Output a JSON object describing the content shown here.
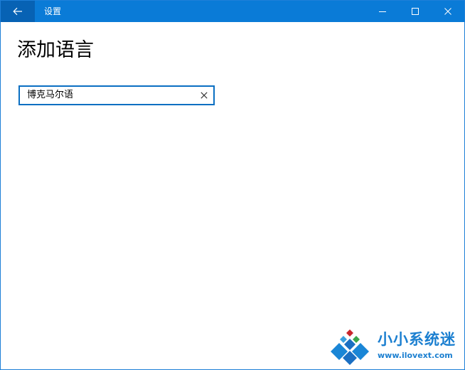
{
  "window": {
    "title": "设置",
    "controls": {
      "minimize_icon": "minimize-icon",
      "maximize_icon": "maximize-icon",
      "close_icon": "close-icon"
    },
    "accent_color": "#0a7bd7",
    "back_button_color": "#0762b4"
  },
  "back_button": {
    "icon": "arrow-left-icon"
  },
  "page": {
    "title": "添加语言"
  },
  "search": {
    "value": "博克马尔语",
    "clear_icon": "clear-x-icon",
    "border_color": "#0a6fc2"
  },
  "watermark": {
    "title": "小小系统迷",
    "url": "www.ilovext.com",
    "color": "#1b7fd0"
  }
}
